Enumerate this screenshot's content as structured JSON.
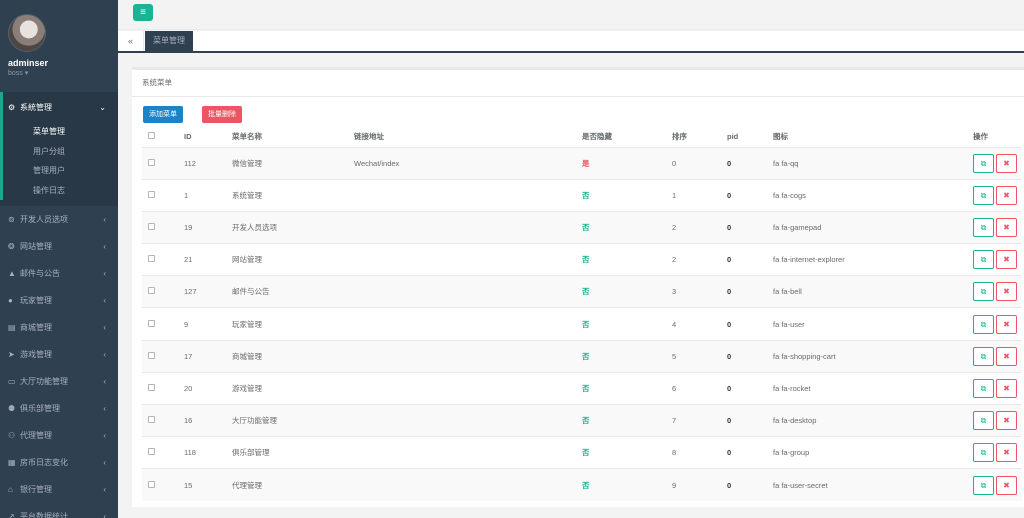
{
  "profile": {
    "name": "adminser",
    "role": "boss ▾"
  },
  "sidebar": {
    "active": {
      "label": "系統管理",
      "icon": "cogs-icon",
      "glyph": "⚙",
      "arrow": "⌄"
    },
    "subs": [
      "菜单管理",
      "用户分组",
      "管理用户",
      "操作日志"
    ],
    "items": [
      {
        "label": "开发人员选项",
        "icon": "gamepad-icon",
        "glyph": "⊚"
      },
      {
        "label": "网站管理",
        "icon": "ie-icon",
        "glyph": "❂"
      },
      {
        "label": "邮件与公告",
        "icon": "bell-icon",
        "glyph": "▲"
      },
      {
        "label": "玩家管理",
        "icon": "user-icon",
        "glyph": "●"
      },
      {
        "label": "商城管理",
        "icon": "cart-icon",
        "glyph": "▤"
      },
      {
        "label": "游戏管理",
        "icon": "rocket-icon",
        "glyph": "➤"
      },
      {
        "label": "大厅功能管理",
        "icon": "desktop-icon",
        "glyph": "▭"
      },
      {
        "label": "俱乐部管理",
        "icon": "group-icon",
        "glyph": "⚉"
      },
      {
        "label": "代理管理",
        "icon": "user-secret-icon",
        "glyph": "⚇"
      },
      {
        "label": "房币日志变化",
        "icon": "calendar-icon",
        "glyph": "▦"
      },
      {
        "label": "银行管理",
        "icon": "bank-icon",
        "glyph": "⌂"
      },
      {
        "label": "平台数据统计",
        "icon": "chart-icon",
        "glyph": "↗"
      }
    ],
    "arrow": "‹"
  },
  "topbar": {
    "menu_glyph": "≡"
  },
  "tabs": {
    "back_glyph": "«",
    "active": "菜单管理"
  },
  "panel": {
    "title": "系统菜单",
    "add_label": "添加菜单",
    "del_label": "批量删除"
  },
  "table": {
    "headers": {
      "id": "ID",
      "name": "菜单名称",
      "url": "链接地址",
      "hide": "是否隐藏",
      "sort": "排序",
      "pid": "pid",
      "icon": "图标",
      "ops": "操作"
    },
    "edit_glyph": "⧉",
    "del_glyph": "✖",
    "rows": [
      {
        "id": "112",
        "name": "微信管理",
        "url": "Wechat/index",
        "hide": "是",
        "sort": "0",
        "pid": "0",
        "icon": "fa fa-qq"
      },
      {
        "id": "1",
        "name": "系统管理",
        "url": "",
        "hide": "否",
        "sort": "1",
        "pid": "0",
        "icon": "fa fa-cogs"
      },
      {
        "id": "19",
        "name": "开发人员选项",
        "url": "",
        "hide": "否",
        "sort": "2",
        "pid": "0",
        "icon": "fa fa-gamepad"
      },
      {
        "id": "21",
        "name": "网站管理",
        "url": "",
        "hide": "否",
        "sort": "2",
        "pid": "0",
        "icon": "fa fa-internet-explorer"
      },
      {
        "id": "127",
        "name": "邮件与公告",
        "url": "",
        "hide": "否",
        "sort": "3",
        "pid": "0",
        "icon": "fa fa-bell"
      },
      {
        "id": "9",
        "name": "玩家管理",
        "url": "",
        "hide": "否",
        "sort": "4",
        "pid": "0",
        "icon": "fa fa-user"
      },
      {
        "id": "17",
        "name": "商城管理",
        "url": "",
        "hide": "否",
        "sort": "5",
        "pid": "0",
        "icon": "fa fa-shopping-cart"
      },
      {
        "id": "20",
        "name": "游戏管理",
        "url": "",
        "hide": "否",
        "sort": "6",
        "pid": "0",
        "icon": "fa fa-rocket"
      },
      {
        "id": "16",
        "name": "大厅功能管理",
        "url": "",
        "hide": "否",
        "sort": "7",
        "pid": "0",
        "icon": "fa fa-desktop"
      },
      {
        "id": "118",
        "name": "俱乐部管理",
        "url": "",
        "hide": "否",
        "sort": "8",
        "pid": "0",
        "icon": "fa fa-group"
      },
      {
        "id": "15",
        "name": "代理管理",
        "url": "",
        "hide": "否",
        "sort": "9",
        "pid": "0",
        "icon": "fa fa-user-secret"
      }
    ]
  }
}
